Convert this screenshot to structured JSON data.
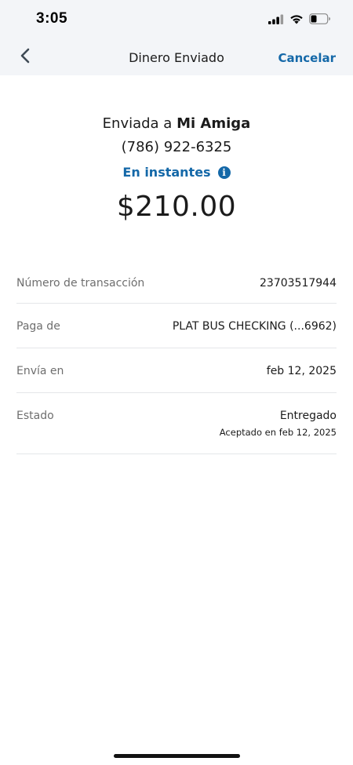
{
  "status_bar": {
    "time": "3:05",
    "icons": [
      "cellular-signal-icon",
      "wifi-icon",
      "battery-icon"
    ]
  },
  "nav": {
    "title": "Dinero Enviado",
    "back_icon": "chevron-left-icon",
    "cancel_label": "Cancelar"
  },
  "summary": {
    "sent_to_prefix": "Enviada a",
    "recipient_name": "Mi Amiga",
    "phone": "(786) 922-6325",
    "speed_label": "En instantes",
    "info_icon_glyph": "i",
    "amount": "$210.00"
  },
  "details": {
    "transaction_label": "Número de transacción",
    "transaction_value": "23703517944",
    "pay_from_label": "Paga de",
    "pay_from_value": "PLAT BUS CHECKING (...6962)",
    "send_on_label": "Envía en",
    "send_on_value": "feb 12, 2025",
    "status_label": "Estado",
    "status_value": "Entregado",
    "status_sub": "Aceptado en feb 12, 2025"
  },
  "colors": {
    "accent": "#1468a8",
    "header_bg": "#f3f5f8",
    "divider": "#e4e6e9",
    "label_gray": "#6e6e6e"
  }
}
